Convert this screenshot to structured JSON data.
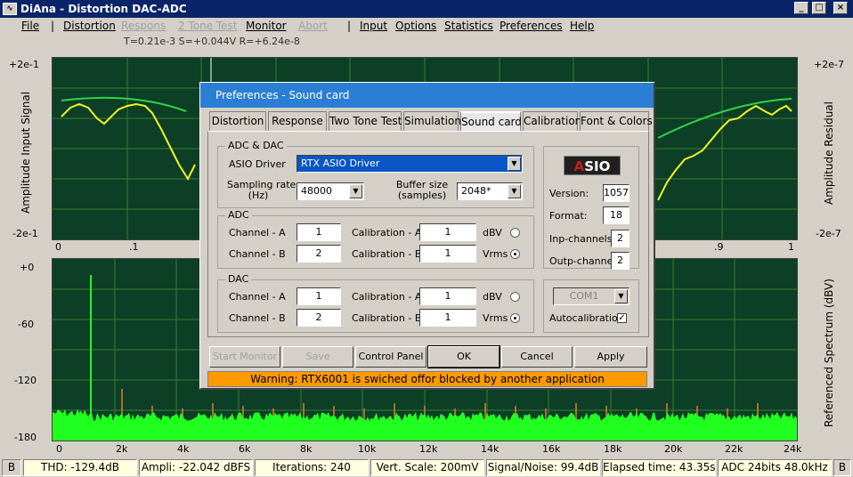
{
  "window": {
    "title": "DiAna - Distortion DAC-ADC",
    "icon": "waveform-icon",
    "controls": {
      "minimize": "_",
      "maximize": "□",
      "close": "×"
    }
  },
  "menu": {
    "file": "File",
    "distortion": "Distortion",
    "respons": "Respons",
    "two_tone": "2 Tone Test",
    "monitor": "Monitor",
    "abort": "Abort",
    "input": "Input",
    "options": "Options",
    "statistics": "Statistics",
    "preferences": "Preferences",
    "help": "Help",
    "sep": "|"
  },
  "readout": "T=0.21e-3  S=+0.044V  R=+6.24e-8",
  "top_plot": {
    "left_label": "Amplitude Input Signal",
    "right_label": "Amplitude Residual",
    "left_top": "+2e-1",
    "left_bottom": "-2e-1",
    "right_top": "+2e-7",
    "right_bottom": "-2e-7",
    "x_ticks": [
      "0",
      ".1",
      ".9",
      "1"
    ],
    "green_color": "#2fd44a",
    "yellow_color": "#f2f226"
  },
  "bottom_plot": {
    "right_label": "Referenced Spectrum (dBV)",
    "y_ticks": [
      "+0",
      "-60",
      "-120",
      "-180"
    ],
    "x_ticks": [
      "0",
      "2k",
      "4k",
      "6k",
      "8k",
      "10k",
      "12k",
      "14k",
      "16k",
      "18k",
      "20k",
      "22k",
      "24k"
    ],
    "spectrum_color": "#20ff20",
    "harmonic_color": "#e08030"
  },
  "dialog": {
    "title": "Preferences - Sound card",
    "tabs": [
      "Distortion",
      "Response",
      "Two Tone Test",
      "Simulation",
      "Sound card",
      "Calibration",
      "Font & Colors"
    ],
    "active_tab": "Sound card",
    "adc_dac": {
      "title": "ADC & DAC",
      "asio_driver_label": "ASIO Driver",
      "asio_driver_value": "RTX ASIO Driver",
      "sampling_rate_label_1": "Sampling rate",
      "sampling_rate_label_2": "(Hz)",
      "sampling_rate_value": "48000",
      "buffer_size_label_1": "Buffer size",
      "buffer_size_label_2": "(samples)",
      "buffer_size_value": "2048*"
    },
    "adc": {
      "title": "ADC",
      "channel_a_label": "Channel - A",
      "channel_a_value": "1",
      "channel_b_label": "Channel - B",
      "channel_b_value": "2",
      "cal_a_label": "Calibration - A",
      "cal_a_value": "1",
      "cal_b_label": "Calibration - B",
      "cal_b_value": "1",
      "unit_dbv": "dBV",
      "unit_vrms": "Vrms",
      "selected_unit": "Vrms"
    },
    "dac": {
      "title": "DAC",
      "channel_a_label": "Channel - A",
      "channel_a_value": "1",
      "channel_b_label": "Channel - B",
      "channel_b_value": "2",
      "cal_a_label": "Calibration - A",
      "cal_a_value": "1",
      "cal_b_label": "Calibration - B",
      "cal_b_value": "1",
      "unit_dbv": "dBV",
      "unit_vrms": "Vrms",
      "selected_unit": "Vrms"
    },
    "asio_info": {
      "logo_text_a": "A",
      "logo_text_rest": "SIO",
      "version_label": "Version:",
      "version_value": "1057",
      "format_label": "Format:",
      "format_value": "18",
      "inp_channels_label": "Inp-channels",
      "inp_channels_value": "2",
      "outp_channels_label": "Outp-channels",
      "outp_channels_value": "2"
    },
    "com": {
      "port_value": "COM1",
      "autocalibration_label": "Autocalibration",
      "autocalibration_checked": true,
      "check_mark": "✓"
    },
    "buttons": {
      "start_monitor": "Start  Monitor",
      "save": "Save",
      "control_panel": "Control Panel",
      "ok": "OK",
      "cancel": "Cancel",
      "apply": "Apply"
    },
    "warning": "Warning: RTX6001 is swiched offor blocked by another application"
  },
  "statusbar": {
    "left_b": "B",
    "thd": "THD: -129.4dB",
    "ampli": "Ampli: -22.042 dBFS",
    "iterations": "Iterations: 240",
    "vert_scale": "Vert. Scale: 200mV",
    "signal_noise": "Signal/Noise:   99.4dB",
    "elapsed": "Elapsed time: 43.35s",
    "adc_info": "ADC 24bits 48.0kHz",
    "right_b": "B"
  }
}
